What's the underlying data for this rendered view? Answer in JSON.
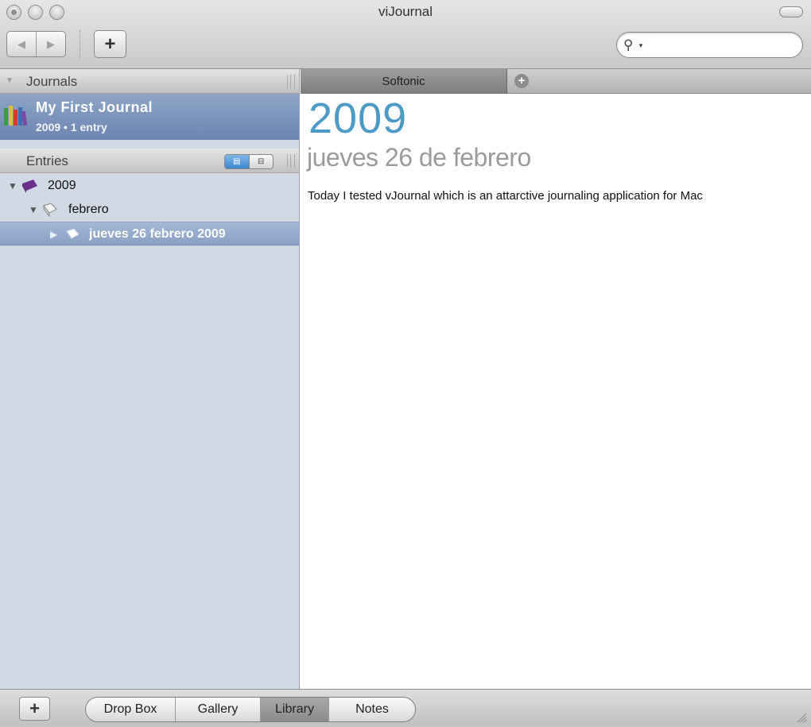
{
  "window": {
    "title": "viJournal"
  },
  "toolbar": {
    "back_label": "◀",
    "forward_label": "▶",
    "add_label": "+",
    "search": {
      "value": "",
      "placeholder": ""
    }
  },
  "sidebar": {
    "journals_header": "Journals",
    "journal": {
      "name": "My First Journal",
      "subtitle": "2009 • 1 entry"
    },
    "entries_header": "Entries",
    "tree": [
      {
        "label": "2009"
      },
      {
        "label": "febrero"
      },
      {
        "label": "jueves 26 febrero 2009"
      }
    ]
  },
  "tabs": [
    {
      "label": "Softonic"
    }
  ],
  "entry": {
    "year": "2009",
    "date": "jueves 26 de febrero",
    "body": "Today I tested vJournal which is an attarctive journaling application for Mac"
  },
  "bottombar": {
    "add_label": "+",
    "segments": [
      "Drop Box",
      "Gallery",
      "Library",
      "Notes"
    ],
    "selected": "Library"
  },
  "colors": {
    "year_accent": "#4c9bc6",
    "selection": "#7d94bb",
    "sidebar_bg": "#d1d9e4"
  }
}
